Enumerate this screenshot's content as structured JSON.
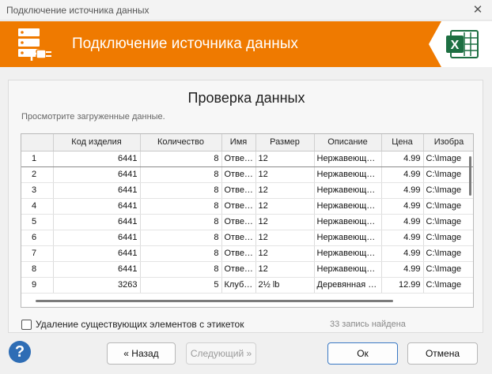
{
  "window": {
    "title": "Подключение источника данных"
  },
  "banner": {
    "title": "Подключение источника данных",
    "accent": "#EF7A00"
  },
  "panel": {
    "title": "Проверка данных",
    "subtitle": "Просмотрите загруженные данные."
  },
  "grid": {
    "columns": [
      "",
      "Код изделия",
      "Количество",
      "Имя",
      "Размер",
      "Описание",
      "Цена",
      "Изобра"
    ],
    "rows": [
      [
        "1",
        "6441",
        "8",
        "Отве…",
        "12",
        "Нержавеющ…",
        "4.99",
        "C:\\Image"
      ],
      [
        "2",
        "6441",
        "8",
        "Отве…",
        "12",
        "Нержавеющ…",
        "4.99",
        "C:\\Image"
      ],
      [
        "3",
        "6441",
        "8",
        "Отве…",
        "12",
        "Нержавеющ…",
        "4.99",
        "C:\\Image"
      ],
      [
        "4",
        "6441",
        "8",
        "Отве…",
        "12",
        "Нержавеющ…",
        "4.99",
        "C:\\Image"
      ],
      [
        "5",
        "6441",
        "8",
        "Отве…",
        "12",
        "Нержавеющ…",
        "4.99",
        "C:\\Image"
      ],
      [
        "6",
        "6441",
        "8",
        "Отве…",
        "12",
        "Нержавеющ…",
        "4.99",
        "C:\\Image"
      ],
      [
        "7",
        "6441",
        "8",
        "Отве…",
        "12",
        "Нержавеющ…",
        "4.99",
        "C:\\Image"
      ],
      [
        "8",
        "6441",
        "8",
        "Отве…",
        "12",
        "Нержавеющ…",
        "4.99",
        "C:\\Image"
      ],
      [
        "9",
        "3263",
        "5",
        "Клуб…",
        "2½ lb",
        "Деревянная …",
        "12.99",
        "C:\\Image"
      ]
    ]
  },
  "options": {
    "delete_label": "Удаление существующих элементов с этикеток"
  },
  "status": {
    "found": "33 запись найдена"
  },
  "buttons": {
    "back": "« Назад",
    "next": "Следующий »",
    "ok": "Ок",
    "cancel": "Отмена"
  },
  "icons": {
    "banner": "database-plug-icon",
    "excel": "excel-icon",
    "help": "help-icon",
    "close": "close-icon"
  }
}
